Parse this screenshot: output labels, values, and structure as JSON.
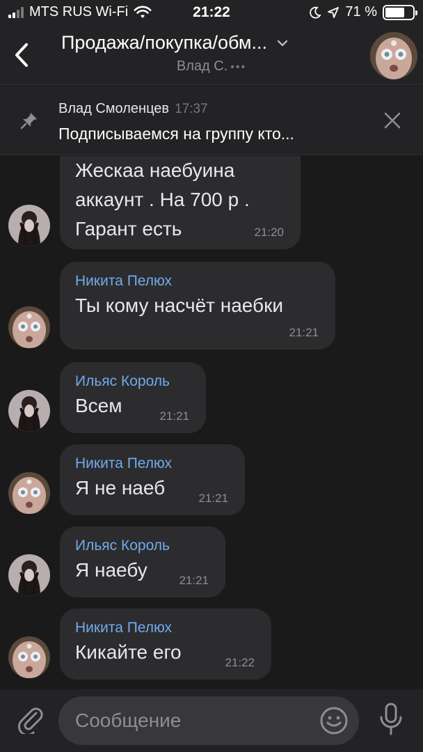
{
  "status_bar": {
    "carrier": "MTS RUS Wi-Fi",
    "time": "21:22",
    "battery": "71 %",
    "battery_level": 0.71
  },
  "header": {
    "title": "Продажа/покупка/обм...",
    "subtitle": "Влад С.",
    "typing_indicator": "•••"
  },
  "pinned": {
    "author": "Влад Смоленцев",
    "time": "17:37",
    "text": "Подписываемся на группу кто..."
  },
  "messages": [
    {
      "sender": "",
      "lines": [
        "Жескаа наебуина",
        "аккаунт . На 700 р .",
        "Гарант есть"
      ],
      "time": "21:20",
      "avatar": "girl"
    },
    {
      "sender": "Никита Пелюх",
      "lines": [
        "Ты кому насчёт наебки"
      ],
      "time": "21:21",
      "avatar": "face"
    },
    {
      "sender": "Ильяс Король",
      "lines": [
        "Всем"
      ],
      "time": "21:21",
      "avatar": "girl"
    },
    {
      "sender": "Никита Пелюх",
      "lines": [
        "Я не наеб"
      ],
      "time": "21:21",
      "avatar": "face"
    },
    {
      "sender": "Ильяс Король",
      "lines": [
        "Я наебу"
      ],
      "time": "21:21",
      "avatar": "girl"
    },
    {
      "sender": "Никита Пелюх",
      "lines": [
        "Кикайте его"
      ],
      "time": "21:22",
      "avatar": "face"
    }
  ],
  "composer": {
    "placeholder": "Сообщение"
  },
  "colors": {
    "background": "#1a1a1b",
    "bar": "#232325",
    "bubble": "#2c2c2e",
    "sender_name": "#71aaeb"
  }
}
